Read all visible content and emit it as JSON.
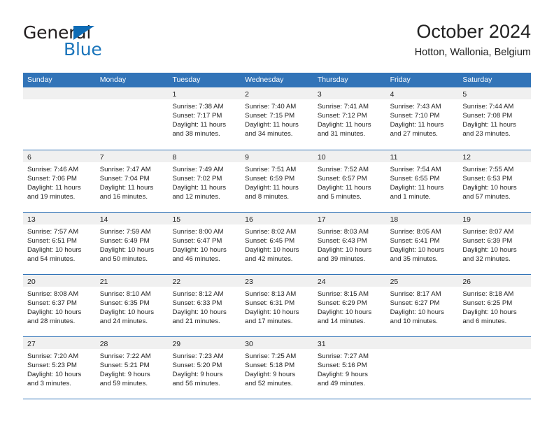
{
  "brand": {
    "name_top": "General",
    "name_bottom": "Blue",
    "triangle_color": "#0f6cb5",
    "top_color": "#231f20",
    "bottom_color": "#1b75bb"
  },
  "header": {
    "title": "October 2024",
    "subtitle": "Hotton, Wallonia, Belgium"
  },
  "theme": {
    "header_blue": "#3274b8",
    "day_band_gray": "#f0f0f0",
    "text": "#222222",
    "page_bg": "#ffffff"
  },
  "weekdays": [
    "Sunday",
    "Monday",
    "Tuesday",
    "Wednesday",
    "Thursday",
    "Friday",
    "Saturday"
  ],
  "weeks": [
    [
      {
        "day": "",
        "lines": []
      },
      {
        "day": "",
        "lines": []
      },
      {
        "day": "1",
        "lines": [
          "Sunrise: 7:38 AM",
          "Sunset: 7:17 PM",
          "Daylight: 11 hours",
          "and 38 minutes."
        ]
      },
      {
        "day": "2",
        "lines": [
          "Sunrise: 7:40 AM",
          "Sunset: 7:15 PM",
          "Daylight: 11 hours",
          "and 34 minutes."
        ]
      },
      {
        "day": "3",
        "lines": [
          "Sunrise: 7:41 AM",
          "Sunset: 7:12 PM",
          "Daylight: 11 hours",
          "and 31 minutes."
        ]
      },
      {
        "day": "4",
        "lines": [
          "Sunrise: 7:43 AM",
          "Sunset: 7:10 PM",
          "Daylight: 11 hours",
          "and 27 minutes."
        ]
      },
      {
        "day": "5",
        "lines": [
          "Sunrise: 7:44 AM",
          "Sunset: 7:08 PM",
          "Daylight: 11 hours",
          "and 23 minutes."
        ]
      }
    ],
    [
      {
        "day": "6",
        "lines": [
          "Sunrise: 7:46 AM",
          "Sunset: 7:06 PM",
          "Daylight: 11 hours",
          "and 19 minutes."
        ]
      },
      {
        "day": "7",
        "lines": [
          "Sunrise: 7:47 AM",
          "Sunset: 7:04 PM",
          "Daylight: 11 hours",
          "and 16 minutes."
        ]
      },
      {
        "day": "8",
        "lines": [
          "Sunrise: 7:49 AM",
          "Sunset: 7:02 PM",
          "Daylight: 11 hours",
          "and 12 minutes."
        ]
      },
      {
        "day": "9",
        "lines": [
          "Sunrise: 7:51 AM",
          "Sunset: 6:59 PM",
          "Daylight: 11 hours",
          "and 8 minutes."
        ]
      },
      {
        "day": "10",
        "lines": [
          "Sunrise: 7:52 AM",
          "Sunset: 6:57 PM",
          "Daylight: 11 hours",
          "and 5 minutes."
        ]
      },
      {
        "day": "11",
        "lines": [
          "Sunrise: 7:54 AM",
          "Sunset: 6:55 PM",
          "Daylight: 11 hours",
          "and 1 minute."
        ]
      },
      {
        "day": "12",
        "lines": [
          "Sunrise: 7:55 AM",
          "Sunset: 6:53 PM",
          "Daylight: 10 hours",
          "and 57 minutes."
        ]
      }
    ],
    [
      {
        "day": "13",
        "lines": [
          "Sunrise: 7:57 AM",
          "Sunset: 6:51 PM",
          "Daylight: 10 hours",
          "and 54 minutes."
        ]
      },
      {
        "day": "14",
        "lines": [
          "Sunrise: 7:59 AM",
          "Sunset: 6:49 PM",
          "Daylight: 10 hours",
          "and 50 minutes."
        ]
      },
      {
        "day": "15",
        "lines": [
          "Sunrise: 8:00 AM",
          "Sunset: 6:47 PM",
          "Daylight: 10 hours",
          "and 46 minutes."
        ]
      },
      {
        "day": "16",
        "lines": [
          "Sunrise: 8:02 AM",
          "Sunset: 6:45 PM",
          "Daylight: 10 hours",
          "and 42 minutes."
        ]
      },
      {
        "day": "17",
        "lines": [
          "Sunrise: 8:03 AM",
          "Sunset: 6:43 PM",
          "Daylight: 10 hours",
          "and 39 minutes."
        ]
      },
      {
        "day": "18",
        "lines": [
          "Sunrise: 8:05 AM",
          "Sunset: 6:41 PM",
          "Daylight: 10 hours",
          "and 35 minutes."
        ]
      },
      {
        "day": "19",
        "lines": [
          "Sunrise: 8:07 AM",
          "Sunset: 6:39 PM",
          "Daylight: 10 hours",
          "and 32 minutes."
        ]
      }
    ],
    [
      {
        "day": "20",
        "lines": [
          "Sunrise: 8:08 AM",
          "Sunset: 6:37 PM",
          "Daylight: 10 hours",
          "and 28 minutes."
        ]
      },
      {
        "day": "21",
        "lines": [
          "Sunrise: 8:10 AM",
          "Sunset: 6:35 PM",
          "Daylight: 10 hours",
          "and 24 minutes."
        ]
      },
      {
        "day": "22",
        "lines": [
          "Sunrise: 8:12 AM",
          "Sunset: 6:33 PM",
          "Daylight: 10 hours",
          "and 21 minutes."
        ]
      },
      {
        "day": "23",
        "lines": [
          "Sunrise: 8:13 AM",
          "Sunset: 6:31 PM",
          "Daylight: 10 hours",
          "and 17 minutes."
        ]
      },
      {
        "day": "24",
        "lines": [
          "Sunrise: 8:15 AM",
          "Sunset: 6:29 PM",
          "Daylight: 10 hours",
          "and 14 minutes."
        ]
      },
      {
        "day": "25",
        "lines": [
          "Sunrise: 8:17 AM",
          "Sunset: 6:27 PM",
          "Daylight: 10 hours",
          "and 10 minutes."
        ]
      },
      {
        "day": "26",
        "lines": [
          "Sunrise: 8:18 AM",
          "Sunset: 6:25 PM",
          "Daylight: 10 hours",
          "and 6 minutes."
        ]
      }
    ],
    [
      {
        "day": "27",
        "lines": [
          "Sunrise: 7:20 AM",
          "Sunset: 5:23 PM",
          "Daylight: 10 hours",
          "and 3 minutes."
        ]
      },
      {
        "day": "28",
        "lines": [
          "Sunrise: 7:22 AM",
          "Sunset: 5:21 PM",
          "Daylight: 9 hours",
          "and 59 minutes."
        ]
      },
      {
        "day": "29",
        "lines": [
          "Sunrise: 7:23 AM",
          "Sunset: 5:20 PM",
          "Daylight: 9 hours",
          "and 56 minutes."
        ]
      },
      {
        "day": "30",
        "lines": [
          "Sunrise: 7:25 AM",
          "Sunset: 5:18 PM",
          "Daylight: 9 hours",
          "and 52 minutes."
        ]
      },
      {
        "day": "31",
        "lines": [
          "Sunrise: 7:27 AM",
          "Sunset: 5:16 PM",
          "Daylight: 9 hours",
          "and 49 minutes."
        ]
      },
      {
        "day": "",
        "lines": []
      },
      {
        "day": "",
        "lines": []
      }
    ]
  ]
}
